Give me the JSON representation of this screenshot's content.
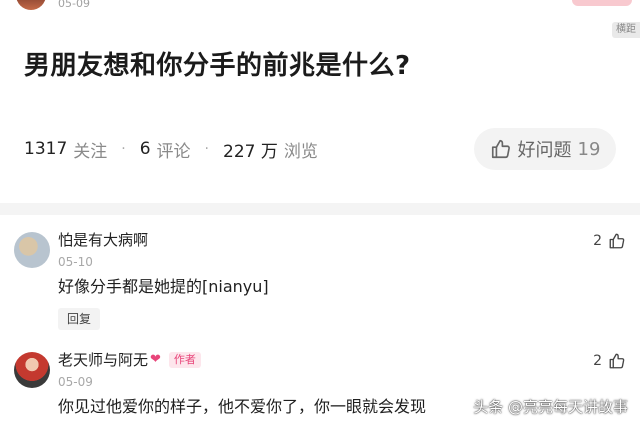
{
  "top": {
    "date": "05-09",
    "tag": "横距"
  },
  "question": {
    "title": "男朋友想和你分手的前兆是什么?",
    "stats": [
      {
        "num": "1317",
        "label": "关注"
      },
      {
        "num": "6",
        "label": "评论"
      },
      {
        "num": "227 万",
        "label": "浏览"
      }
    ],
    "good_question": {
      "label": "好问题",
      "count": "19"
    }
  },
  "comments": [
    {
      "name": "怕是有大病啊",
      "date": "05-10",
      "text": "好像分手都是她提的[nianyu]",
      "reply_label": "回复",
      "likes": "2"
    },
    {
      "name": "老天师与阿无",
      "author_tag": "作者",
      "date": "05-09",
      "text": "你见过他爱你的样子，他不爱你了，你一眼就会发现",
      "likes": "2"
    }
  ],
  "watermark": "头条 @亮亮每天讲故事",
  "colors": {
    "accent_pink": "#e8457a",
    "divider": "#f4f4f4"
  }
}
